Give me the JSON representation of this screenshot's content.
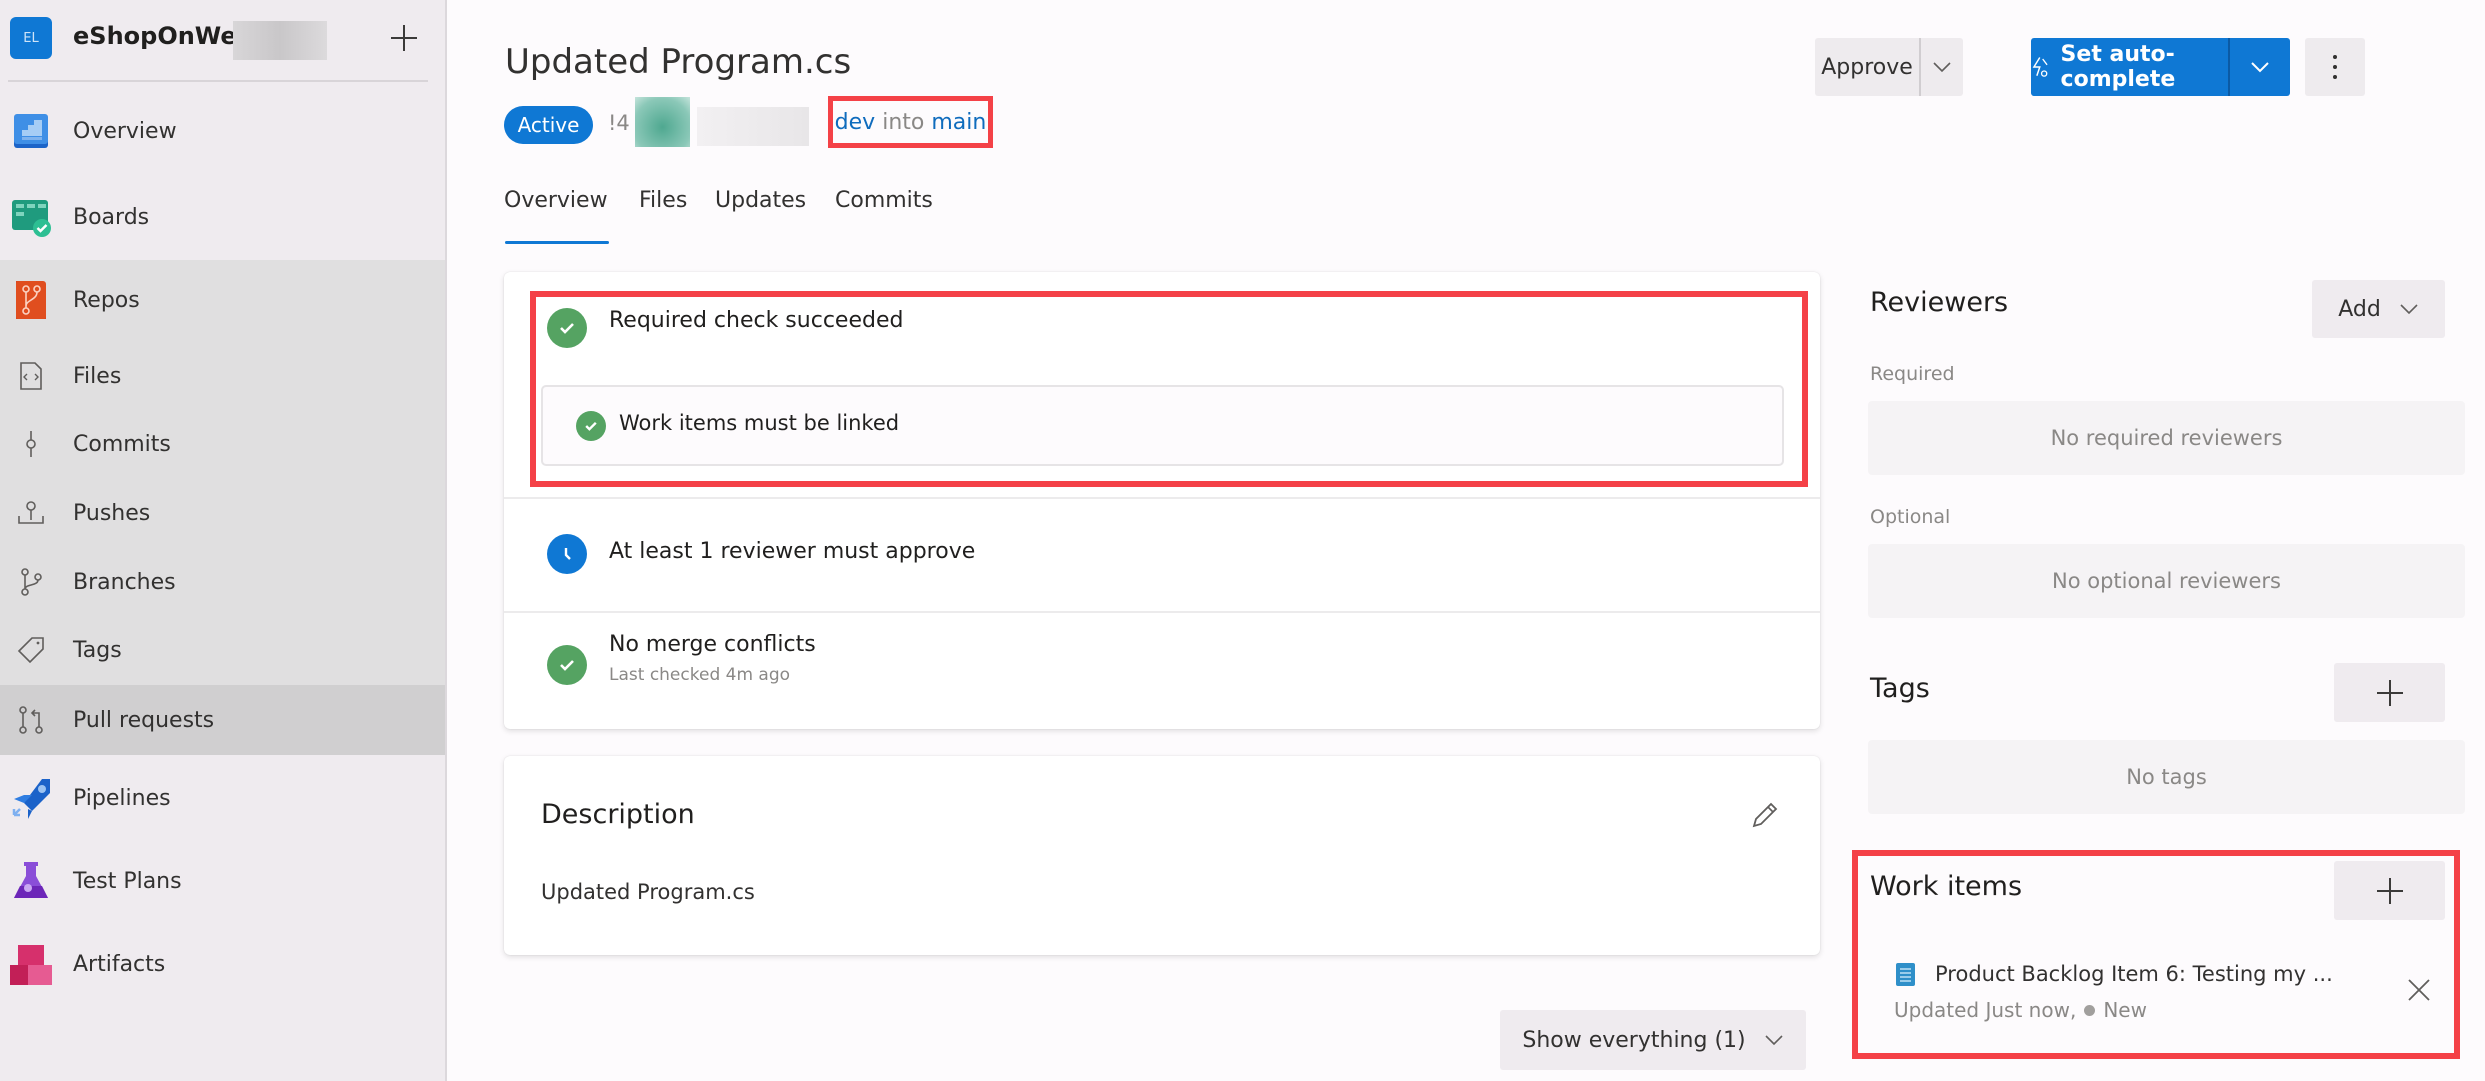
{
  "sidebar": {
    "project": {
      "initials": "EL",
      "name": "eShopOnWeb"
    },
    "items": [
      {
        "label": "Overview",
        "icon": "overview-icon"
      },
      {
        "label": "Boards",
        "icon": "boards-icon"
      },
      {
        "label": "Repos",
        "icon": "repos-icon"
      },
      {
        "label": "Files",
        "icon": "files-icon"
      },
      {
        "label": "Commits",
        "icon": "commits-icon"
      },
      {
        "label": "Pushes",
        "icon": "pushes-icon"
      },
      {
        "label": "Branches",
        "icon": "branches-icon"
      },
      {
        "label": "Tags",
        "icon": "tags-icon"
      },
      {
        "label": "Pull requests",
        "icon": "pull-requests-icon",
        "selected": true
      },
      {
        "label": "Pipelines",
        "icon": "pipelines-icon"
      },
      {
        "label": "Test Plans",
        "icon": "test-plans-icon"
      },
      {
        "label": "Artifacts",
        "icon": "artifacts-icon"
      }
    ]
  },
  "pr": {
    "title": "Updated Program.cs",
    "status": "Active",
    "id": "!4",
    "source_branch": "dev",
    "into": "into",
    "target_branch": "main"
  },
  "tabs": [
    {
      "label": "Overview",
      "active": true
    },
    {
      "label": "Files"
    },
    {
      "label": "Updates"
    },
    {
      "label": "Commits"
    }
  ],
  "actions": {
    "approve": "Approve",
    "auto_complete": "Set auto-complete"
  },
  "checks": [
    {
      "text": "Required check succeeded",
      "status": "succeeded"
    },
    {
      "text": "Work items must be linked",
      "status": "succeeded"
    },
    {
      "text": "At least 1 reviewer must approve",
      "status": "waiting"
    },
    {
      "text": "No merge conflicts",
      "sub": "Last checked 4m ago",
      "status": "succeeded"
    }
  ],
  "description": {
    "title": "Description",
    "text": "Updated Program.cs"
  },
  "show_everything": "Show everything (1)",
  "reviewers": {
    "title": "Reviewers",
    "add_label": "Add",
    "required_label": "Required",
    "required_empty": "No required reviewers",
    "optional_label": "Optional",
    "optional_empty": "No optional reviewers"
  },
  "tags": {
    "title": "Tags",
    "empty": "No tags"
  },
  "work_items": {
    "title": "Work items",
    "items": [
      {
        "title": "Product Backlog Item 6: Testing my ...",
        "updated": "Updated Just now,",
        "state": "New"
      }
    ]
  },
  "colors": {
    "accent": "#0f78d4",
    "success": "#55a362",
    "highlight": "#f44147"
  }
}
